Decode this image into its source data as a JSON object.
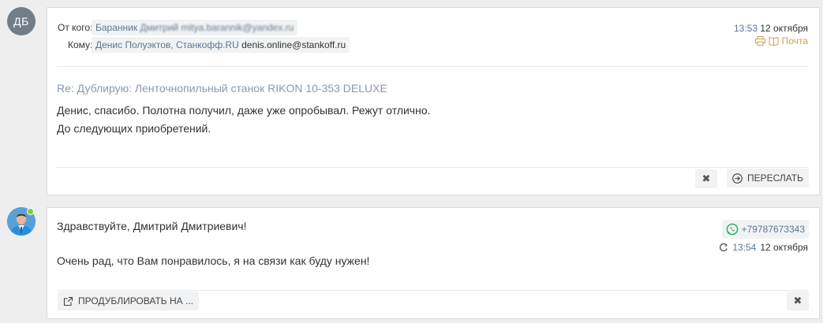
{
  "message1": {
    "avatar_initials": "ДБ",
    "from_label": "От кого:",
    "from_name": "Баранник",
    "from_hidden": "Дмитрий mitya.barannik@yandex.ru",
    "to_label": "Кому:",
    "to_name": "Денис Полуэктов, Станкофф.RU",
    "to_email": "denis.online@stankoff.ru",
    "time": "13:53",
    "date": "12 октября",
    "mail_label": "Почта",
    "subject": "Re: Дублирую: Ленточнопильный станок RIKON 10-353 DELUXE",
    "body_line1": "Денис, спасибо. Полотна получил, даже уже опробывал. Режут отлично.",
    "body_line2": "До следующих приобретений.",
    "close_glyph": "✖",
    "forward_label": "ПЕРЕСЛАТЬ"
  },
  "message2": {
    "greeting": "Здравствуйте, Дмитрий Дмитриевич!",
    "body": "Очень рад, что Вам понравилось, я на связи как буду нужен!",
    "phone": "+79787673343",
    "time": "13:54",
    "date": "12 октября",
    "duplicate_label": "ПРОДУБЛИРОВАТЬ НА ...",
    "close_glyph": "✖"
  },
  "colors": {
    "link": "#5d7691",
    "gold": "#c9a64d",
    "online": "#7ac943",
    "whatsapp": "#25a55a"
  }
}
